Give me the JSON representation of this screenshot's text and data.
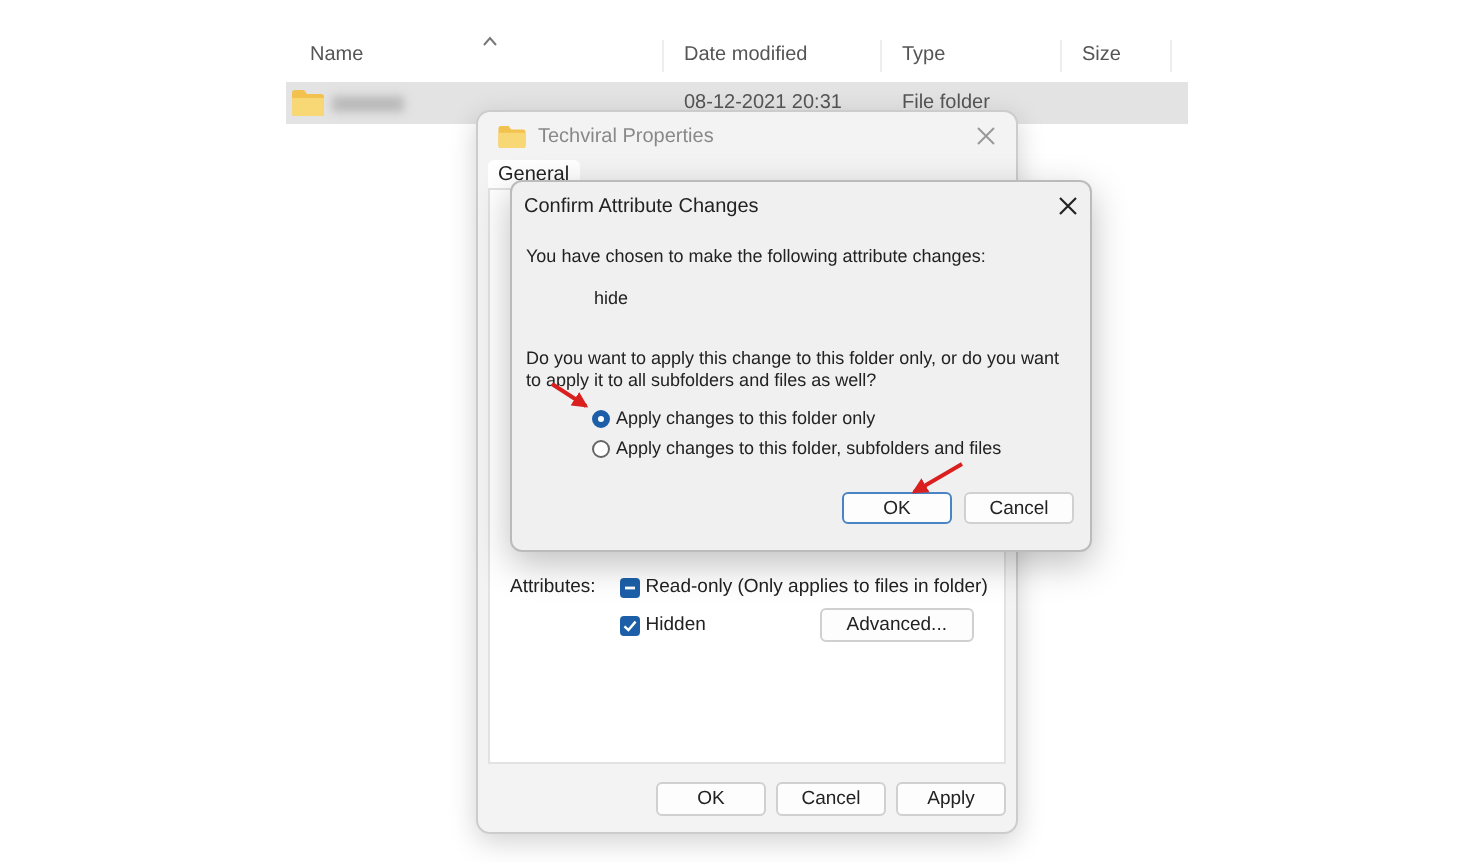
{
  "explorer": {
    "columns": [
      {
        "label": "Name",
        "sorted": true
      },
      {
        "label": "Date modified",
        "sorted": false
      },
      {
        "label": "Type",
        "sorted": false
      },
      {
        "label": "Size",
        "sorted": false
      }
    ],
    "rows": [
      {
        "date": "08-12-2021 20:31",
        "type": "File folder",
        "selected": true
      }
    ]
  },
  "properties": {
    "title": "Techviral Properties",
    "tabs": [
      {
        "label": "General",
        "selected": true
      }
    ],
    "attributes_label": "Attributes:",
    "attributes": [
      {
        "label": "Read-only (Only applies to files in folder)",
        "checked": true,
        "indeterminate": true
      },
      {
        "label": "Hidden",
        "checked": true,
        "indeterminate": false
      }
    ],
    "advanced_button": "Advanced...",
    "buttons": [
      "OK",
      "Cancel",
      "Apply"
    ]
  },
  "dialog": {
    "title": "Confirm Attribute Changes",
    "intro": "You have chosen to make the following attribute changes:",
    "change": "hide",
    "question": "Do you want to apply this change to this folder only, or do you want to apply it to all subfolders and files as well?",
    "options": [
      {
        "label": "Apply changes to this folder only",
        "selected": true
      },
      {
        "label": "Apply changes to this folder, subfolders and files",
        "selected": false
      }
    ],
    "buttons": [
      {
        "label": "OK",
        "default": true
      },
      {
        "label": "Cancel",
        "default": false
      }
    ]
  }
}
